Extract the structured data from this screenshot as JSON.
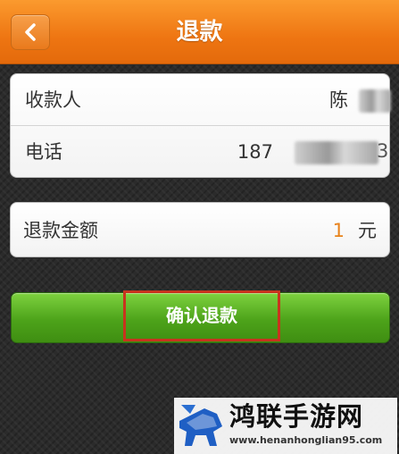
{
  "header": {
    "title": "退款",
    "back_icon": "chevron-left-icon",
    "background": "#ee7512"
  },
  "payee": {
    "label": "收款人",
    "value": "陈"
  },
  "phone": {
    "label": "电话",
    "value": "187",
    "tail": "3"
  },
  "refund": {
    "label": "退款金额",
    "amount": "1",
    "unit": "元",
    "amount_color": "#e8821a"
  },
  "confirm": {
    "label": "确认退款",
    "background": "#4da31a",
    "highlight_color": "#c8341e"
  },
  "watermark": {
    "title": "鸿联手游网",
    "url": "www.henanhonglian95.com"
  }
}
